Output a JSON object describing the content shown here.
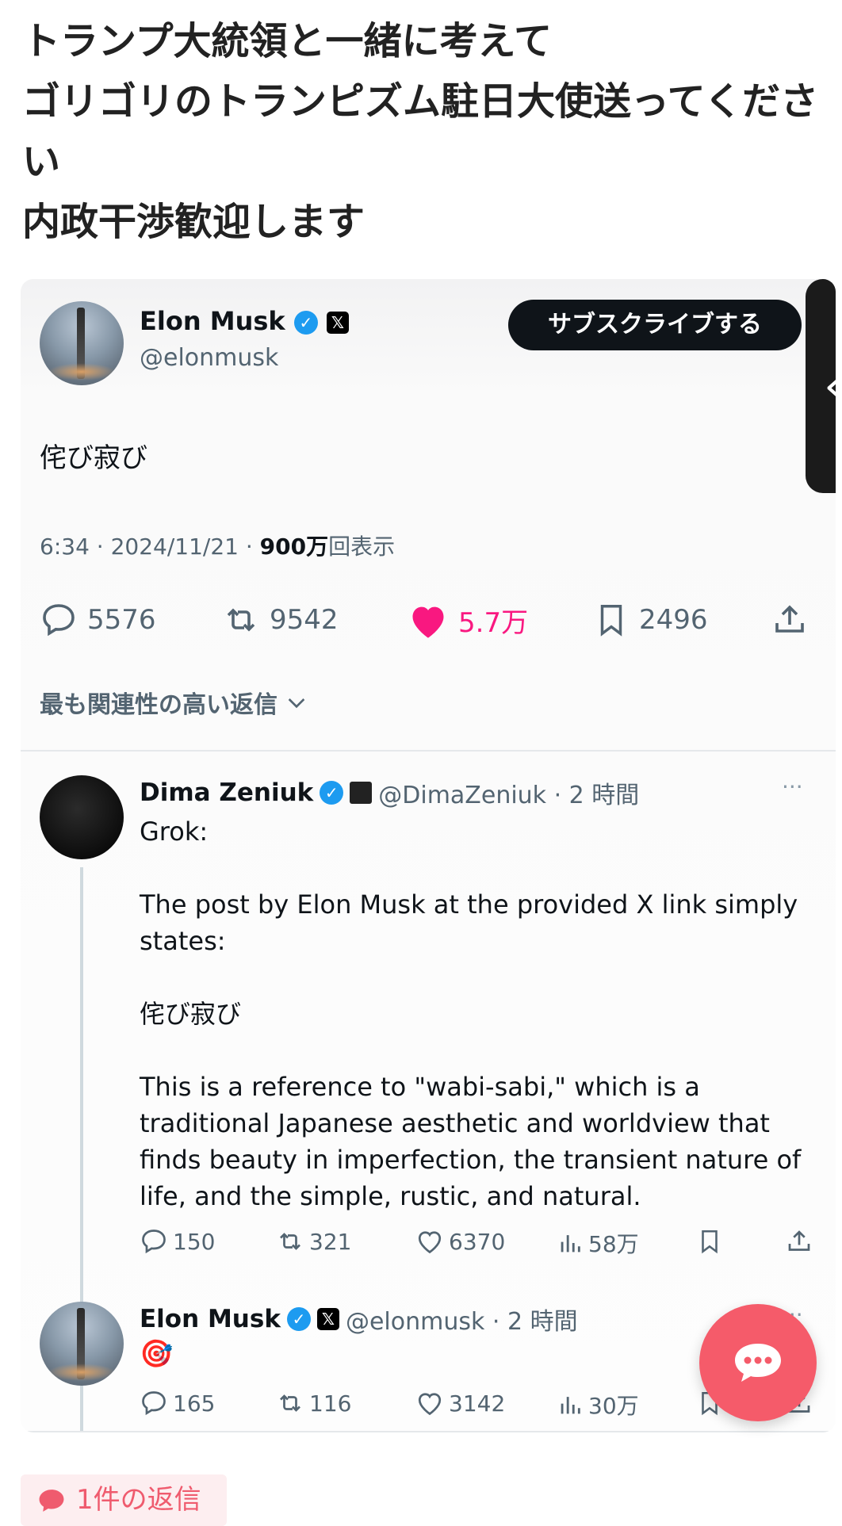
{
  "post": {
    "text": "トランプ大統領と一緒に考えて\nゴリゴリのトランピズム駐日大使送ってください\n内政干渉歓迎します"
  },
  "tweet": {
    "author_name": "Elon Musk",
    "verified_mark": "✓",
    "x_badge": "𝕏",
    "handle": "@elonmusk",
    "subscribe_label": "サブスクライブする",
    "side_tab_glyph": "‹",
    "text": "侘び寂び",
    "time": "6:34 · 2024/11/21 · ",
    "views_count": "900万",
    "views_label": "回表示",
    "stats": {
      "replies": "5576",
      "retweets": "9542",
      "likes": "5.7万",
      "bookmarks": "2496"
    },
    "relevant_replies_label": "最も関連性の高い返信",
    "like_color": "#f91880"
  },
  "reply1": {
    "author_name": "Dima Zeniuk",
    "handle_time": "@DimaZeniuk · 2 時間",
    "more": "···",
    "text": "Grok:\n\nThe post by Elon Musk at the provided X link simply states:\n\n侘び寂び\n\nThis is a reference to \"wabi-sabi,\" which is a traditional Japanese aesthetic and worldview that finds beauty in imperfection, the transient nature of life, and the simple, rustic, and natural.",
    "stats": {
      "replies": "150",
      "retweets": "321",
      "likes": "6370",
      "views": "58万"
    }
  },
  "reply2": {
    "author_name": "Elon Musk",
    "handle_time": "@elonmusk · 2 時間",
    "more": "···",
    "text": "🎯",
    "stats": {
      "replies": "165",
      "retweets": "116",
      "likes": "3142",
      "views": "30万"
    }
  },
  "reply_count_badge": "1件の返信",
  "accent_color": "#f55b6a"
}
